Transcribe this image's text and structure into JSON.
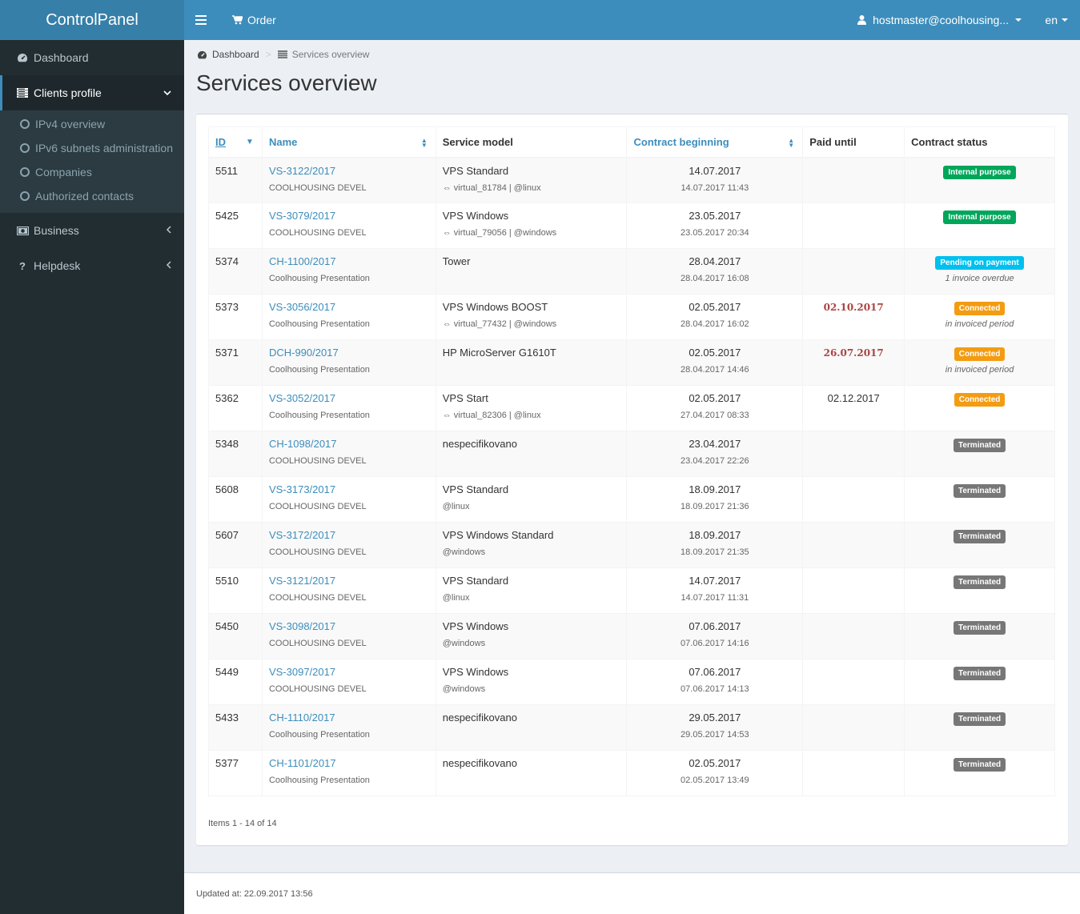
{
  "app": {
    "title": "ControlPanel"
  },
  "topbar": {
    "order_label": "Order",
    "user_label": "hostmaster@coolhousing...",
    "lang_label": "en"
  },
  "sidebar": {
    "items": [
      {
        "label": "Dashboard",
        "icon": "dashboard-icon"
      },
      {
        "label": "Clients profile",
        "icon": "list-icon",
        "active": true,
        "children": [
          "IPv4 overview",
          "IPv6 subnets administration",
          "Companies",
          "Authorized contacts"
        ]
      },
      {
        "label": "Business",
        "icon": "money-icon"
      },
      {
        "label": "Helpdesk",
        "icon": "question-icon"
      }
    ]
  },
  "breadcrumb": {
    "home": "Dashboard",
    "separator": ">",
    "current": "Services overview"
  },
  "page": {
    "title": "Services overview"
  },
  "table": {
    "columns": [
      "ID",
      "Name",
      "Service model",
      "Contract beginning",
      "Paid until",
      "Contract status"
    ],
    "rows": [
      {
        "id": "5511",
        "name": "VS-3122/2017",
        "company": "COOLHOUSING DEVEL",
        "model": "VPS Standard",
        "model_sub": "⇔ virtual_81784 | @linux",
        "begin": "14.07.2017",
        "created": "14.07.2017 11:43",
        "paid": "",
        "paid_overdue": false,
        "status": "Internal purpose",
        "status_color": "#00a65a",
        "note": ""
      },
      {
        "id": "5425",
        "name": "VS-3079/2017",
        "company": "COOLHOUSING DEVEL",
        "model": "VPS Windows",
        "model_sub": "⇔ virtual_79056 | @windows",
        "begin": "23.05.2017",
        "created": "23.05.2017 20:34",
        "paid": "",
        "paid_overdue": false,
        "status": "Internal purpose",
        "status_color": "#00a65a",
        "note": ""
      },
      {
        "id": "5374",
        "name": "CH-1100/2017",
        "company": "Coolhousing Presentation",
        "model": "Tower",
        "model_sub": "",
        "begin": "28.04.2017",
        "created": "28.04.2017 16:08",
        "paid": "",
        "paid_overdue": false,
        "status": "Pending on payment",
        "status_color": "#00c0ef",
        "note": "1 invoice overdue"
      },
      {
        "id": "5373",
        "name": "VS-3056/2017",
        "company": "Coolhousing Presentation",
        "model": "VPS Windows BOOST",
        "model_sub": "⇔ virtual_77432 | @windows",
        "begin": "02.05.2017",
        "created": "28.04.2017 16:02",
        "paid": "02.10.2017",
        "paid_overdue": true,
        "status": "Connected",
        "status_color": "#f39c12",
        "note": "in invoiced period"
      },
      {
        "id": "5371",
        "name": "DCH-990/2017",
        "company": "Coolhousing Presentation",
        "model": "HP MicroServer G1610T",
        "model_sub": "",
        "begin": "02.05.2017",
        "created": "28.04.2017 14:46",
        "paid": "26.07.2017",
        "paid_overdue": true,
        "status": "Connected",
        "status_color": "#f39c12",
        "note": "in invoiced period"
      },
      {
        "id": "5362",
        "name": "VS-3052/2017",
        "company": "Coolhousing Presentation",
        "model": "VPS Start",
        "model_sub": "⇔ virtual_82306 | @linux",
        "begin": "02.05.2017",
        "created": "27.04.2017 08:33",
        "paid": "02.12.2017",
        "paid_overdue": false,
        "status": "Connected",
        "status_color": "#f39c12",
        "note": ""
      },
      {
        "id": "5348",
        "name": "CH-1098/2017",
        "company": "COOLHOUSING DEVEL",
        "model": "nespecifikovano",
        "model_sub": "",
        "begin": "23.04.2017",
        "created": "23.04.2017 22:26",
        "paid": "",
        "paid_overdue": false,
        "status": "Terminated",
        "status_color": "#777777",
        "note": ""
      },
      {
        "id": "5608",
        "name": "VS-3173/2017",
        "company": "COOLHOUSING DEVEL",
        "model": "VPS Standard",
        "model_sub": "@linux",
        "begin": "18.09.2017",
        "created": "18.09.2017 21:36",
        "paid": "",
        "paid_overdue": false,
        "status": "Terminated",
        "status_color": "#777777",
        "note": ""
      },
      {
        "id": "5607",
        "name": "VS-3172/2017",
        "company": "COOLHOUSING DEVEL",
        "model": "VPS Windows Standard",
        "model_sub": "@windows",
        "begin": "18.09.2017",
        "created": "18.09.2017 21:35",
        "paid": "",
        "paid_overdue": false,
        "status": "Terminated",
        "status_color": "#777777",
        "note": ""
      },
      {
        "id": "5510",
        "name": "VS-3121/2017",
        "company": "COOLHOUSING DEVEL",
        "model": "VPS Standard",
        "model_sub": "@linux",
        "begin": "14.07.2017",
        "created": "14.07.2017 11:31",
        "paid": "",
        "paid_overdue": false,
        "status": "Terminated",
        "status_color": "#777777",
        "note": ""
      },
      {
        "id": "5450",
        "name": "VS-3098/2017",
        "company": "COOLHOUSING DEVEL",
        "model": "VPS Windows",
        "model_sub": "@windows",
        "begin": "07.06.2017",
        "created": "07.06.2017 14:16",
        "paid": "",
        "paid_overdue": false,
        "status": "Terminated",
        "status_color": "#777777",
        "note": ""
      },
      {
        "id": "5449",
        "name": "VS-3097/2017",
        "company": "COOLHOUSING DEVEL",
        "model": "VPS Windows",
        "model_sub": "@windows",
        "begin": "07.06.2017",
        "created": "07.06.2017 14:13",
        "paid": "",
        "paid_overdue": false,
        "status": "Terminated",
        "status_color": "#777777",
        "note": ""
      },
      {
        "id": "5433",
        "name": "CH-1110/2017",
        "company": "Coolhousing Presentation",
        "model": "nespecifikovano",
        "model_sub": "",
        "begin": "29.05.2017",
        "created": "29.05.2017 14:53",
        "paid": "",
        "paid_overdue": false,
        "status": "Terminated",
        "status_color": "#777777",
        "note": ""
      },
      {
        "id": "5377",
        "name": "CH-1101/2017",
        "company": "Coolhousing Presentation",
        "model": "nespecifikovano",
        "model_sub": "",
        "begin": "02.05.2017",
        "created": "02.05.2017 13:49",
        "paid": "",
        "paid_overdue": false,
        "status": "Terminated",
        "status_color": "#777777",
        "note": ""
      }
    ]
  },
  "pagination": {
    "info": "Items 1 - 14 of 14"
  },
  "footer": {
    "updated": "Updated at: 22.09.2017 13:56"
  },
  "colors": {
    "brand": "#3c8dbc",
    "brand_dark": "#367fa9",
    "sidebar": "#222d32",
    "overdue": "#a94442"
  }
}
